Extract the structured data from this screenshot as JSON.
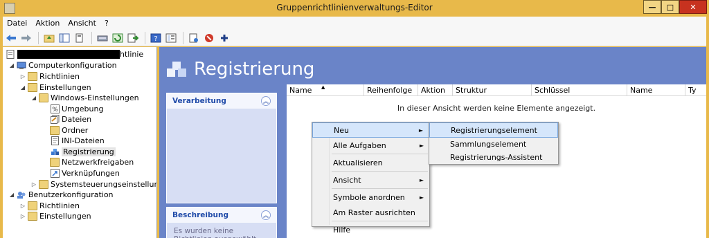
{
  "window": {
    "title": "Gruppenrichtlinienverwaltungs-Editor",
    "min_label": "—",
    "max_label": "□",
    "close_label": "✕"
  },
  "menubar": {
    "items": [
      "Datei",
      "Aktion",
      "Ansicht",
      "?"
    ]
  },
  "toolbar": {
    "icons": [
      "back-icon",
      "forward-icon",
      "up-folder-icon",
      "show-hide-tree-icon",
      "copy-icon",
      "properties-icon",
      "refresh-icon",
      "export-icon",
      "help-icon",
      "view-icon",
      "new-icon",
      "delete-icon",
      "add-icon"
    ]
  },
  "tree": {
    "root_suffix": "htlinie",
    "items": [
      {
        "label": "Computerkonfiguration"
      },
      {
        "label": "Richtlinien"
      },
      {
        "label": "Einstellungen"
      },
      {
        "label": "Windows-Einstellungen"
      },
      {
        "label": "Umgebung"
      },
      {
        "label": "Dateien"
      },
      {
        "label": "Ordner"
      },
      {
        "label": "INI-Dateien"
      },
      {
        "label": "Registrierung"
      },
      {
        "label": "Netzwerkfreigaben"
      },
      {
        "label": "Verknüpfungen"
      },
      {
        "label": "Systemsteuerungseinstellungen"
      },
      {
        "label": "Benutzerkonfiguration"
      },
      {
        "label": "Richtlinien"
      },
      {
        "label": "Einstellungen"
      }
    ]
  },
  "main": {
    "banner_title": "Registrierung",
    "panels": {
      "processing_title": "Verarbeitung",
      "description_title": "Beschreibung",
      "description_text": "Es wurden keine Richtlinien ausgewählt."
    },
    "list": {
      "columns": [
        "Name",
        "Reihenfolge",
        "Aktion",
        "Struktur",
        "Schlüssel",
        "Name",
        "Ty"
      ],
      "empty_text": "In dieser Ansicht werden keine Elemente angezeigt."
    }
  },
  "context_menu": {
    "items": [
      "Neu",
      "Alle Aufgaben",
      "Aktualisieren",
      "Ansicht",
      "Symbole anordnen",
      "Am Raster ausrichten",
      "Hilfe"
    ]
  },
  "submenu": {
    "items": [
      "Registrierungselement",
      "Sammlungselement",
      "Registrierungs-Assistent"
    ]
  },
  "colors": {
    "frame": "#e8b94a",
    "pane_background": "#6a84c8",
    "panel_title": "#1f4aa8",
    "highlight": "#d5e6fb"
  }
}
